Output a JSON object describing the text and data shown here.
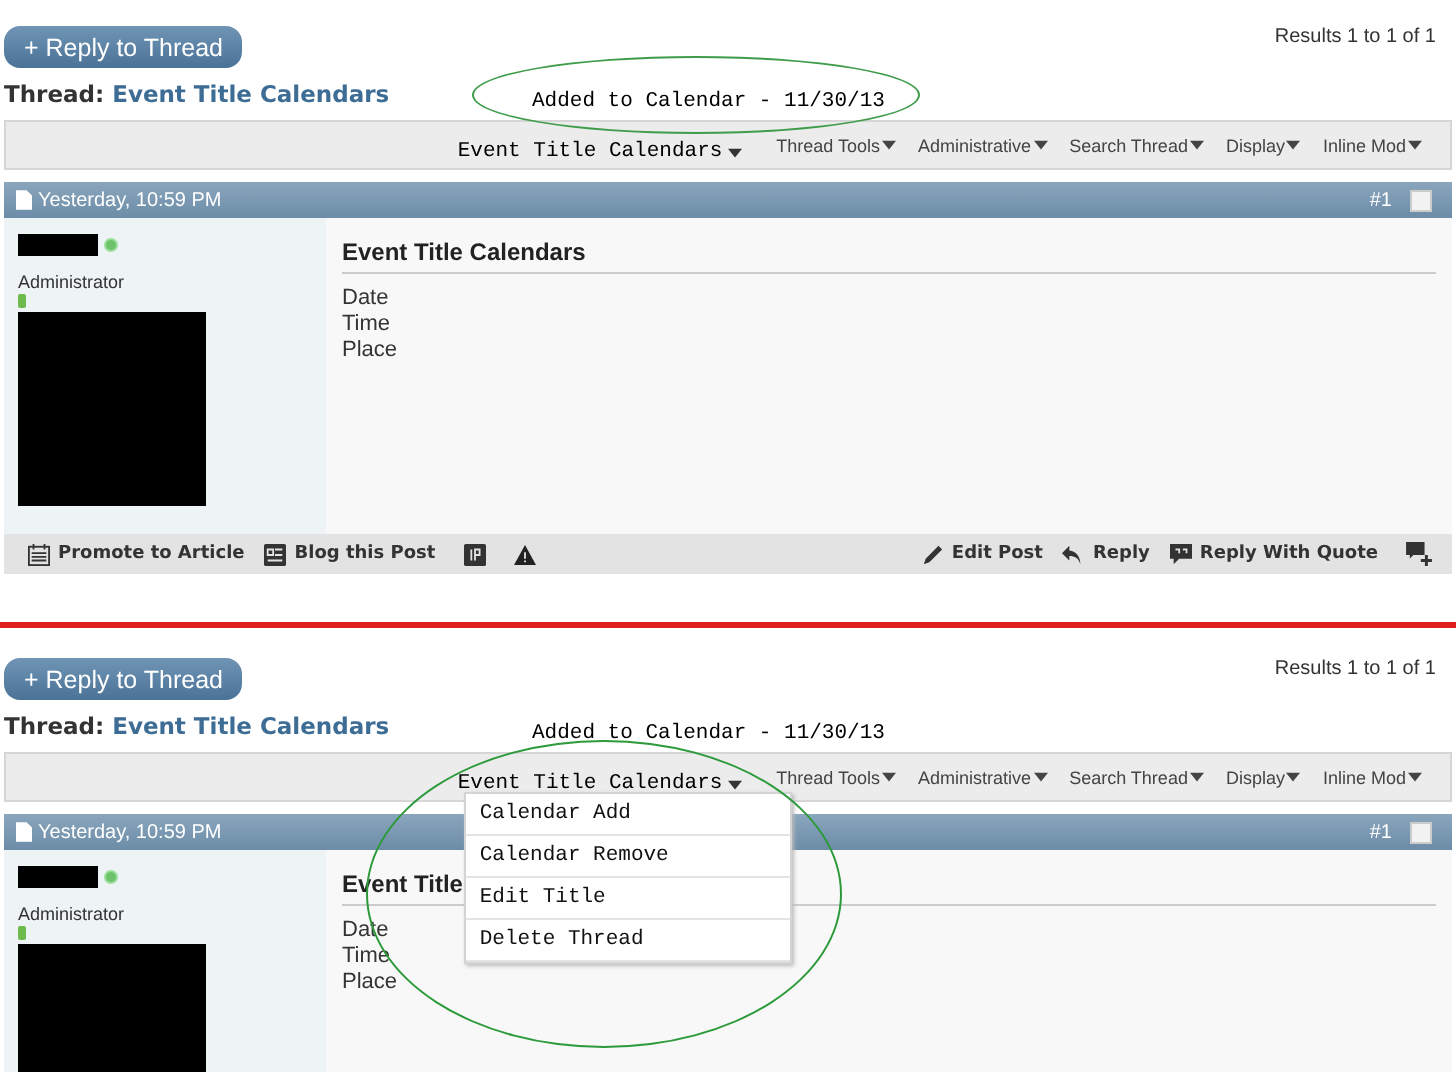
{
  "panels": [
    {
      "note_circled": true,
      "reply_button": "+ Reply to Thread",
      "results": "Results 1 to 1 of 1",
      "thread_label": "Thread:",
      "thread_title": "Event Title Calendars",
      "calendar_note": "Added to Calendar - 11/30/13",
      "menu_button": "Event Title Calendars",
      "tools": [
        "Thread Tools",
        "Administrative",
        "Search Thread",
        "Display",
        "Inline Mod"
      ],
      "post": {
        "date": "Yesterday, 10:59 PM",
        "number": "#1",
        "checked": false,
        "role": "Administrator",
        "online": true,
        "title": "Event Title Calendars",
        "lines": [
          "Date",
          "Time",
          "Place"
        ],
        "footer_left": [
          "Promote to Article",
          "Blog this Post"
        ],
        "footer_right": [
          "Edit Post",
          "Reply",
          "Reply With Quote"
        ]
      }
    },
    {
      "menu_circled": true,
      "reply_button": "+ Reply to Thread",
      "results": "Results 1 to 1 of 1",
      "thread_label": "Thread:",
      "thread_title": "Event Title Calendars",
      "calendar_note": "Added to Calendar - 11/30/13",
      "menu_button": "Event Title Calendars",
      "menu_items": [
        "Calendar Add",
        "Calendar Remove",
        "Edit Title",
        "Delete Thread"
      ],
      "tools": [
        "Thread Tools",
        "Administrative",
        "Search Thread",
        "Display",
        "Inline Mod"
      ],
      "post": {
        "date": "Yesterday, 10:59 PM",
        "number": "#1",
        "checked": false,
        "role": "Administrator",
        "online": true,
        "title": "Event Title",
        "lines": [
          "Date",
          "Time",
          "Place"
        ]
      }
    }
  ]
}
